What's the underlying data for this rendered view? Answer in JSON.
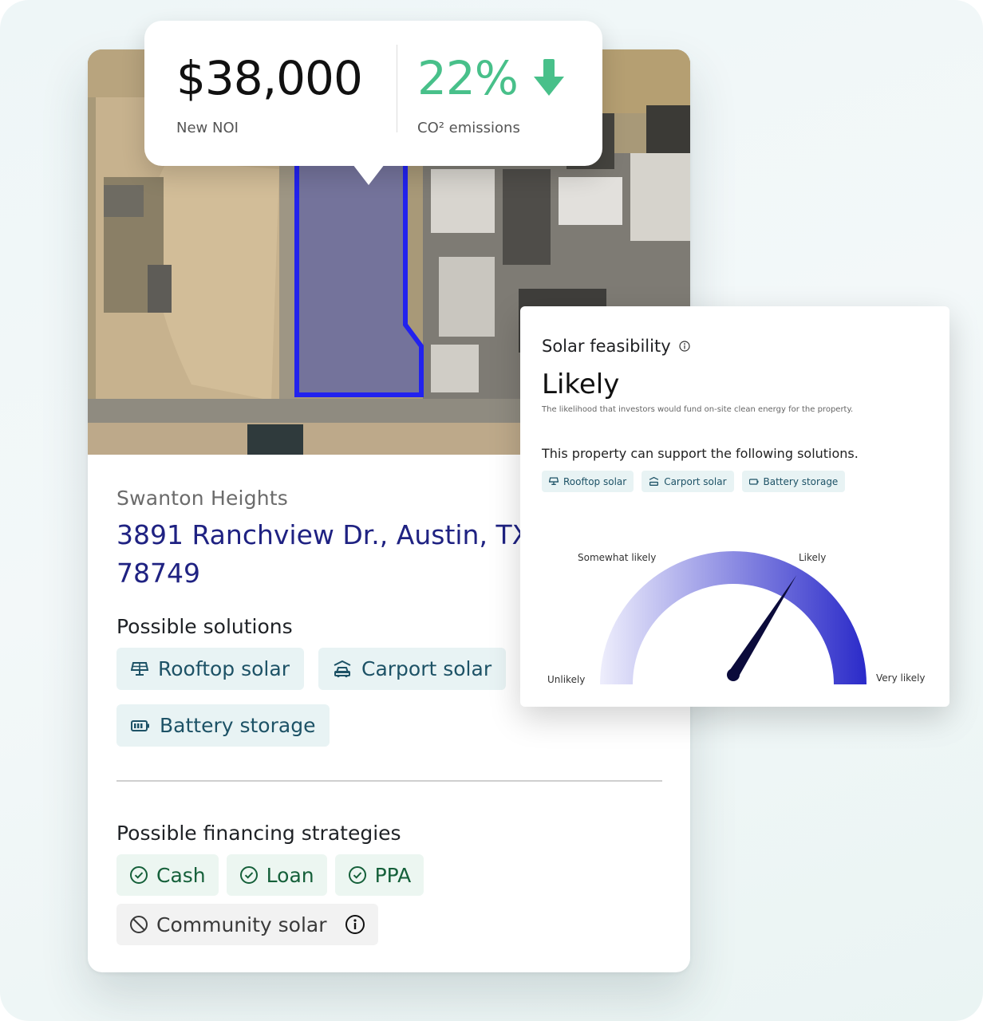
{
  "kpi": {
    "noi_value": "$38,000",
    "noi_label": "New NOI",
    "co2_value": "22%",
    "co2_label": "CO² emissions",
    "co2_color": "#48c08a",
    "co2_icon": "arrow-down-icon"
  },
  "property": {
    "name": "Swanton Heights",
    "address": "3891 Ranchview Dr., Austin, TX 78749",
    "solutions_title": "Possible solutions",
    "solutions": [
      {
        "label": "Rooftop solar",
        "icon": "solar-panel-icon"
      },
      {
        "label": "Carport solar",
        "icon": "carport-icon"
      },
      {
        "label": "Battery storage",
        "icon": "battery-icon"
      }
    ],
    "financing_title": "Possible financing strategies",
    "financing": [
      {
        "label": "Cash",
        "icon": "check-circle-icon",
        "available": true
      },
      {
        "label": "Loan",
        "icon": "check-circle-icon",
        "available": true
      },
      {
        "label": "PPA",
        "icon": "check-circle-icon",
        "available": true
      },
      {
        "label": "Community solar",
        "icon": "block-icon",
        "available": false
      }
    ]
  },
  "feasibility": {
    "title": "Solar feasibility",
    "status": "Likely",
    "description": "The likelihood that investors would fund on-site clean energy for the property.",
    "support_text": "This property can support the following solutions.",
    "solutions": [
      "Rooftop solar",
      "Carport solar",
      "Battery storage"
    ],
    "gauge": {
      "labels": [
        "Unlikely",
        "Somewhat likely",
        "Likely",
        "Very likely"
      ],
      "value_fraction": 0.68,
      "color_start": "#eeeefc",
      "color_end": "#2a2ac9"
    }
  },
  "colors": {
    "address": "#1f2282",
    "boundary": "#2222ee"
  }
}
